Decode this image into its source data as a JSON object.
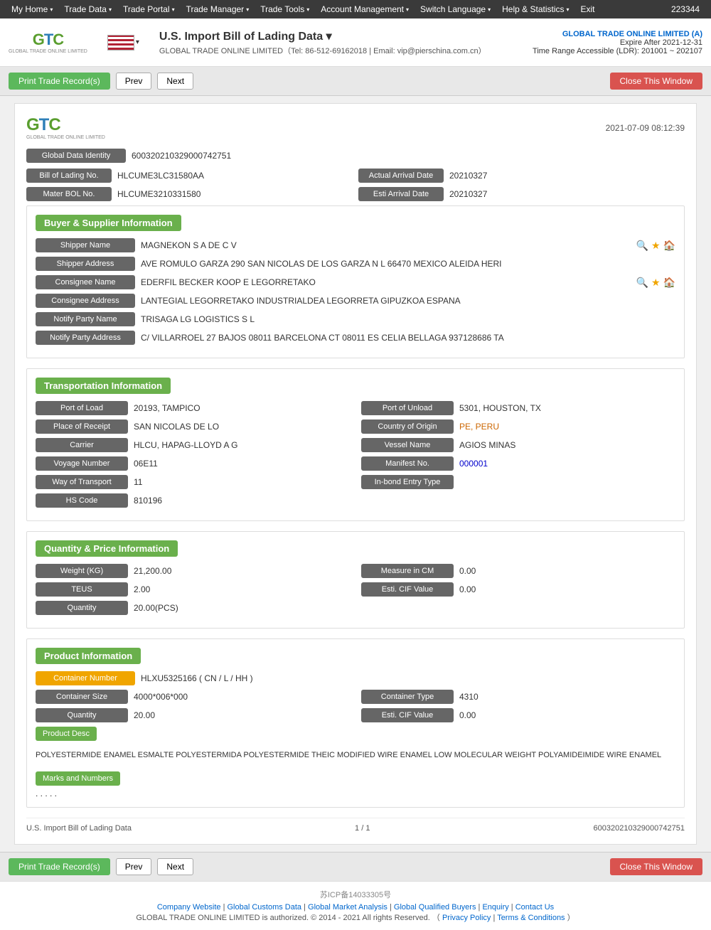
{
  "topNav": {
    "items": [
      {
        "label": "My Home",
        "hasDropdown": true
      },
      {
        "label": "Trade Data",
        "hasDropdown": true
      },
      {
        "label": "Trade Portal",
        "hasDropdown": true
      },
      {
        "label": "Trade Manager",
        "hasDropdown": true
      },
      {
        "label": "Trade Tools",
        "hasDropdown": true
      },
      {
        "label": "Account Management",
        "hasDropdown": true
      },
      {
        "label": "Switch Language",
        "hasDropdown": true
      },
      {
        "label": "Help & Statistics",
        "hasDropdown": true
      },
      {
        "label": "Exit",
        "hasDropdown": false
      }
    ],
    "userCode": "223344"
  },
  "header": {
    "title": "U.S. Import Bill of Lading Data ▾",
    "subtitle": "GLOBAL TRADE ONLINE LIMITED（Tel: 86-512-69162018 | Email: vip@pierschina.com.cn）",
    "company": "GLOBAL TRADE ONLINE LIMITED (A)",
    "expireLabel": "Expire After 2021-12-31",
    "timeRange": "Time Range Accessible (LDR): 201001 ~ 202107"
  },
  "toolbar": {
    "printLabel": "Print Trade Record(s)",
    "prevLabel": "Prev",
    "nextLabel": "Next",
    "closeLabel": "Close This Window"
  },
  "document": {
    "logoText": "GTC",
    "logoSub": "GLOBAL TRADE ONLINE LIMITED",
    "timestamp": "2021-07-09 08:12:39",
    "globalDataIdentityLabel": "Global Data Identity",
    "globalDataIdentityValue": "600320210329000742751",
    "bolNoLabel": "Bill of Lading No.",
    "bolNoValue": "HLCUME3LC31580AA",
    "actualArrivalDateLabel": "Actual Arrival Date",
    "actualArrivalDateValue": "20210327",
    "materBolLabel": "Mater BOL No.",
    "materBolValue": "HLCUME3210331580",
    "estiArrivalLabel": "Esti Arrival Date",
    "estiArrivalValue": "20210327"
  },
  "buyerSupplier": {
    "sectionTitle": "Buyer & Supplier Information",
    "shipperNameLabel": "Shipper Name",
    "shipperNameValue": "MAGNEKON S A DE C V",
    "shipperAddressLabel": "Shipper Address",
    "shipperAddressValue": "AVE ROMULO GARZA 290 SAN NICOLAS DE LOS GARZA N L 66470 MEXICO ALEIDA HERI",
    "consigneeNameLabel": "Consignee Name",
    "consigneeNameValue": "EDERFIL BECKER KOOP E LEGORRETAKO",
    "consigneeAddressLabel": "Consignee Address",
    "consigneeAddressValue": "LANTEGIAL LEGORRETAKO INDUSTRIALDEA LEGORRETA GIPUZKOA ESPANA",
    "notifyPartyNameLabel": "Notify Party Name",
    "notifyPartyNameValue": "TRISAGA LG LOGISTICS S L",
    "notifyPartyAddressLabel": "Notify Party Address",
    "notifyPartyAddressValue": "C/ VILLARROEL 27 BAJOS 08011 BARCELONA CT 08011 ES CELIA BELLAGA 937128686 TA"
  },
  "transportation": {
    "sectionTitle": "Transportation Information",
    "portOfLoadLabel": "Port of Load",
    "portOfLoadValue": "20193, TAMPICO",
    "portOfUnloadLabel": "Port of Unload",
    "portOfUnloadValue": "5301, HOUSTON, TX",
    "placeOfReceiptLabel": "Place of Receipt",
    "placeOfReceiptValue": "SAN NICOLAS DE LO",
    "countryOfOriginLabel": "Country of Origin",
    "countryOfOriginValue": "PE, PERU",
    "carrierLabel": "Carrier",
    "carrierValue": "HLCU, HAPAG-LLOYD A G",
    "vesselNameLabel": "Vessel Name",
    "vesselNameValue": "AGIOS MINAS",
    "voyageNumberLabel": "Voyage Number",
    "voyageNumberValue": "06E11",
    "manifestNoLabel": "Manifest No.",
    "manifestNoValue": "000001",
    "wayOfTransportLabel": "Way of Transport",
    "wayOfTransportValue": "11",
    "inBondEntryTypeLabel": "In-bond Entry Type",
    "inBondEntryTypeValue": "",
    "hsCodeLabel": "HS Code",
    "hsCodeValue": "810196"
  },
  "quantity": {
    "sectionTitle": "Quantity & Price Information",
    "weightLabel": "Weight (KG)",
    "weightValue": "21,200.00",
    "measureInCMLabel": "Measure in CM",
    "measureInCMValue": "0.00",
    "teusLabel": "TEUS",
    "teusValue": "2.00",
    "estiCifValueLabel": "Esti. CIF Value",
    "estiCifValueValue": "0.00",
    "quantityLabel": "Quantity",
    "quantityValue": "20.00(PCS)"
  },
  "product": {
    "sectionTitle": "Product Information",
    "containerNumberLabel": "Container Number",
    "containerNumberValue": "HLXU5325166 ( CN / L / HH )",
    "containerSizeLabel": "Container Size",
    "containerSizeValue": "4000*006*000",
    "containerTypeLabel": "Container Type",
    "containerTypeValue": "4310",
    "quantityLabel": "Quantity",
    "quantityValue": "20.00",
    "estiCifValueLabel": "Esti. CIF Value",
    "estiCifValueValue": "0.00",
    "productDescLabel": "Product Desc",
    "productDescValue": "POLYESTERMIDE ENAMEL ESMALTE POLYESTERMIDA POLYESTERMIDE THEIC MODIFIED WIRE ENAMEL LOW MOLECULAR WEIGHT POLYAMIDEIMIDE WIRE ENAMEL",
    "marksLabel": "Marks and Numbers",
    "marksValue": ". . . . ."
  },
  "docFooter": {
    "leftText": "U.S. Import Bill of Lading Data",
    "pageInfo": "1 / 1",
    "rightText": "600320210329000742751"
  },
  "siteFooter": {
    "icp": "苏ICP备14033305号",
    "links": [
      "Company Website",
      "Global Customs Data",
      "Global Market Analysis",
      "Global Qualified Buyers",
      "Enquiry",
      "Contact Us"
    ],
    "copyright": "GLOBAL TRADE ONLINE LIMITED is authorized. © 2014 - 2021 All rights Reserved.  （",
    "privacyLabel": "Privacy Policy",
    "termsLabel": "Terms & Conditions",
    "copyrightEnd": "）"
  }
}
